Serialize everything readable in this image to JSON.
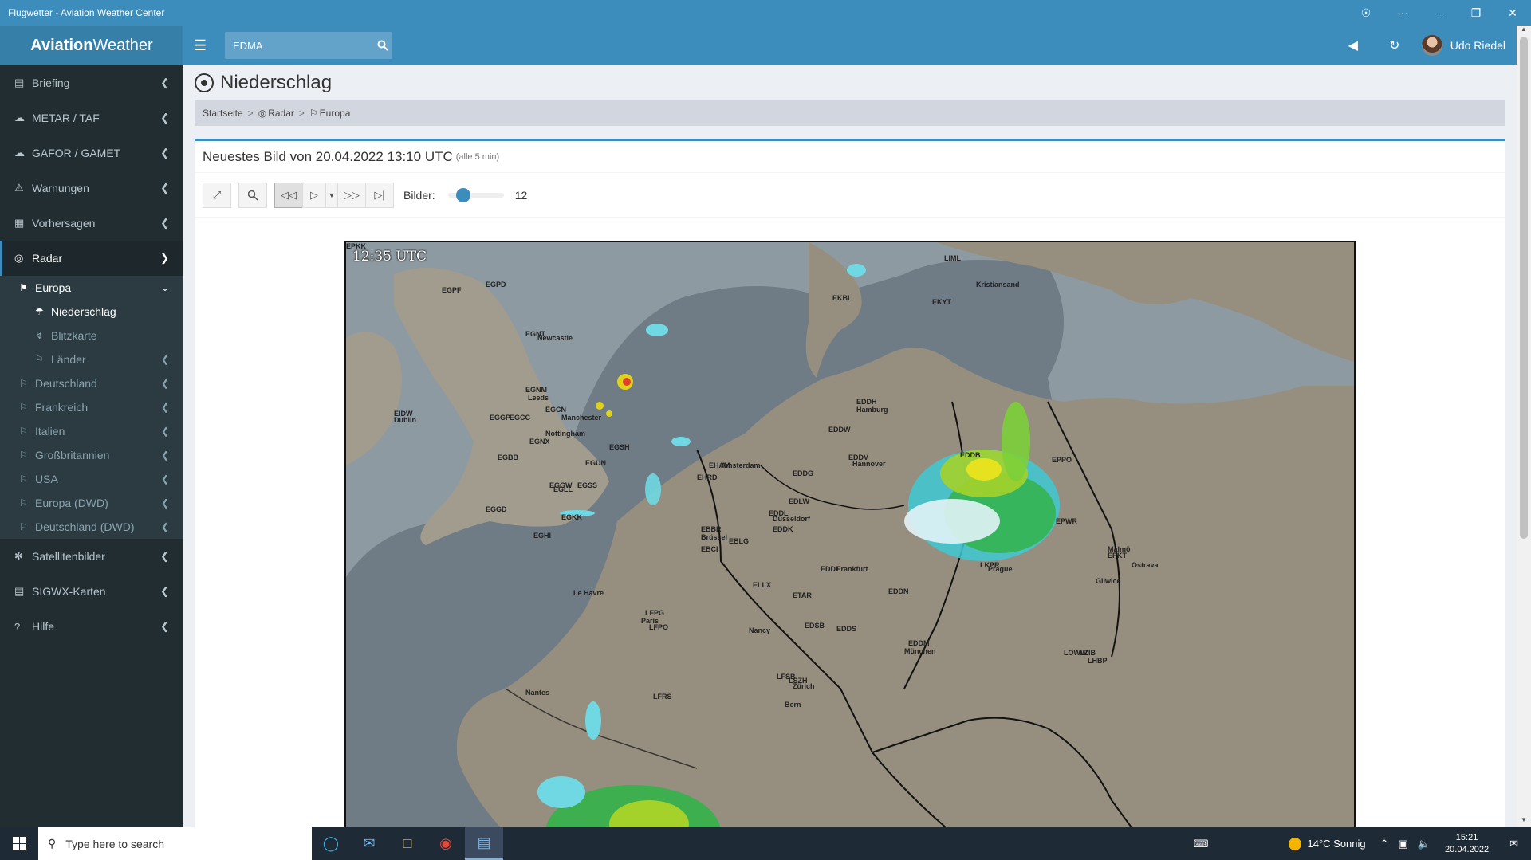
{
  "window": {
    "title": "Flugwetter - Aviation Weather Center"
  },
  "header": {
    "logo_bold": "Aviation",
    "logo_rest": "Weather",
    "search_value": "EDMA",
    "user_name": "Udo Riedel"
  },
  "sidebar": {
    "items": [
      {
        "label": "Briefing"
      },
      {
        "label": "METAR / TAF"
      },
      {
        "label": "GAFOR / GAMET"
      },
      {
        "label": "Warnungen"
      },
      {
        "label": "Vorhersagen"
      },
      {
        "label": "Radar"
      }
    ],
    "radar_sub": [
      {
        "label": "Europa"
      },
      {
        "label": "Niederschlag"
      },
      {
        "label": "Blitzkarte"
      },
      {
        "label": "Länder"
      },
      {
        "label": "Deutschland"
      },
      {
        "label": "Frankreich"
      },
      {
        "label": "Italien"
      },
      {
        "label": "Großbritannien"
      },
      {
        "label": "USA"
      },
      {
        "label": "Europa (DWD)"
      },
      {
        "label": "Deutschland (DWD)"
      }
    ],
    "bottom_items": [
      {
        "label": "Satellitenbilder"
      },
      {
        "label": "SIGWX-Karten"
      },
      {
        "label": "Hilfe"
      }
    ]
  },
  "page": {
    "title": "Niederschlag",
    "breadcrumb": [
      "Startseite",
      "Radar",
      "Europa"
    ],
    "box_title": "Neuestes Bild von 20.04.2022 13:10 UTC",
    "box_note": "(alle 5 min)",
    "bilder_label": "Bilder:",
    "bilder_value": "12",
    "bilder_fraction": 0.12,
    "radar_time": "12:35 UTC"
  },
  "map_labels": [
    "EGPF",
    "EGPD",
    "EGNT",
    "Newcastle",
    "EGNM",
    "Leeds",
    "EGCN",
    "Manchester",
    "EGGP",
    "EGCC",
    "EGNX",
    "Nottingham",
    "EGBB",
    "EGSH",
    "EGUN",
    "EGGW",
    "EGSS",
    "EGLL",
    "EGKK",
    "EGGD",
    "EGHI",
    "EIDW",
    "Dublin",
    "EHAM",
    "Amsterdam",
    "EHRD",
    "EBBR",
    "Brüssel",
    "EBLG",
    "EBCI",
    "EDDL",
    "Düsseldorf",
    "EDDK",
    "EDDG",
    "EDLW",
    "EDDH",
    "Hamburg",
    "EDDW",
    "EDDV",
    "Hannover",
    "EDDB",
    "EPWR",
    "EPPO",
    "EKBI",
    "EKYT",
    "Kristiansand",
    "EDDF",
    "Frankfurt",
    "ETAR",
    "EDDN",
    "EDSB",
    "EDDS",
    "EDDM",
    "München",
    "LKPR",
    "Prague",
    "LOWW",
    "LZIB",
    "LHBP",
    "ELLX",
    "LFPG",
    "Paris",
    "LFPO",
    "Nancy",
    "LSZH",
    "Zürich",
    "LFSB",
    "Bern",
    "Nantes",
    "Le Havre",
    "LFRS",
    "LIML",
    "Malmö",
    "EPKT",
    "Gliwice",
    "Ostrava",
    "EPKK"
  ],
  "taskbar": {
    "search_placeholder": "Type here to search",
    "weather": "14°C  Sonnig",
    "time": "15:21",
    "date": "20.04.2022"
  }
}
